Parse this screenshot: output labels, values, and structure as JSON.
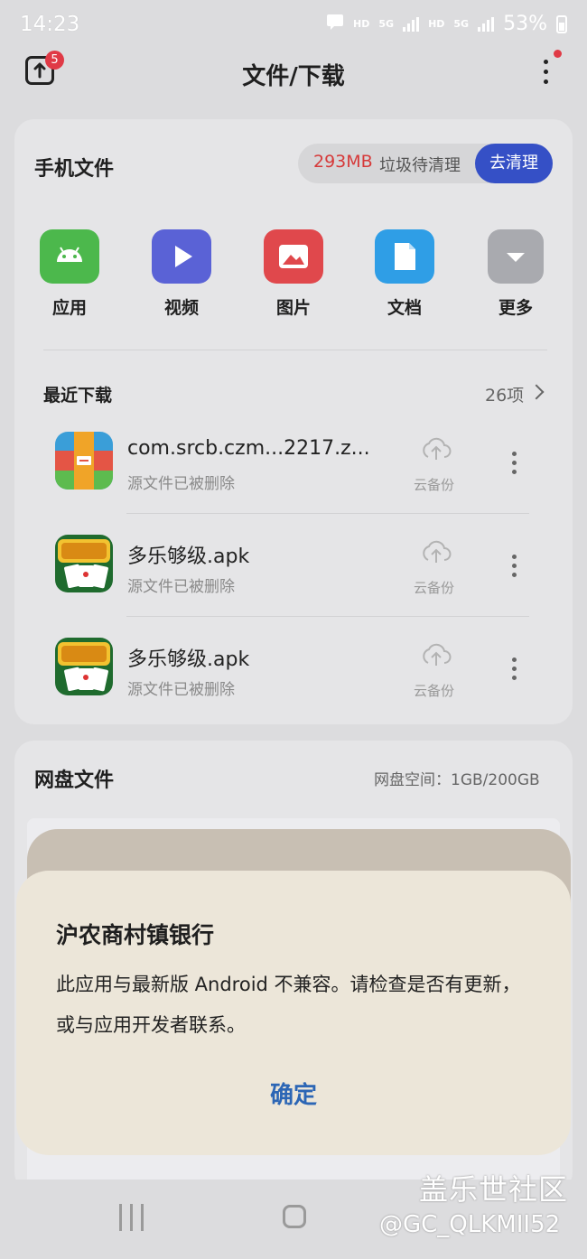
{
  "status_bar": {
    "time": "14:23",
    "hd1": "HD",
    "net1": "5G",
    "hd2": "HD",
    "net2": "5G",
    "battery": "53%"
  },
  "header": {
    "title": "文件/下载",
    "upload_badge": "5"
  },
  "phone_files": {
    "title": "手机文件",
    "junk_size": "293MB",
    "junk_label": "垃圾待清理",
    "clean_button": "去清理",
    "categories": [
      {
        "label": "应用",
        "icon": "android-icon",
        "color": "#4cb84c"
      },
      {
        "label": "视频",
        "icon": "play-icon",
        "color": "#5a62d6"
      },
      {
        "label": "图片",
        "icon": "image-icon",
        "color": "#e0484c"
      },
      {
        "label": "文档",
        "icon": "document-icon",
        "color": "#2f9ee6"
      },
      {
        "label": "更多",
        "icon": "chevron-down-icon",
        "color": "#a9aaaf"
      }
    ]
  },
  "recent_downloads": {
    "title": "最近下载",
    "count": "26项",
    "items": [
      {
        "name": "com.srcb.czm...2217.z...",
        "status": "源文件已被删除",
        "action": "云备份"
      },
      {
        "name": "多乐够级.apk",
        "status": "源文件已被删除",
        "action": "云备份"
      },
      {
        "name": "多乐够级.apk",
        "status": "源文件已被删除",
        "action": "云备份"
      }
    ]
  },
  "cloud_disk": {
    "title": "网盘文件",
    "space": "网盘空间：1GB/200GB"
  },
  "dialog": {
    "title": "沪农商村镇银行",
    "message": "此应用与最新版 Android 不兼容。请检查是否有更新，或与应用开发者联系。",
    "ok_button": "确定"
  },
  "watermark": {
    "line1": "盖乐世社区",
    "line2": "@GC_QLKMII52"
  }
}
